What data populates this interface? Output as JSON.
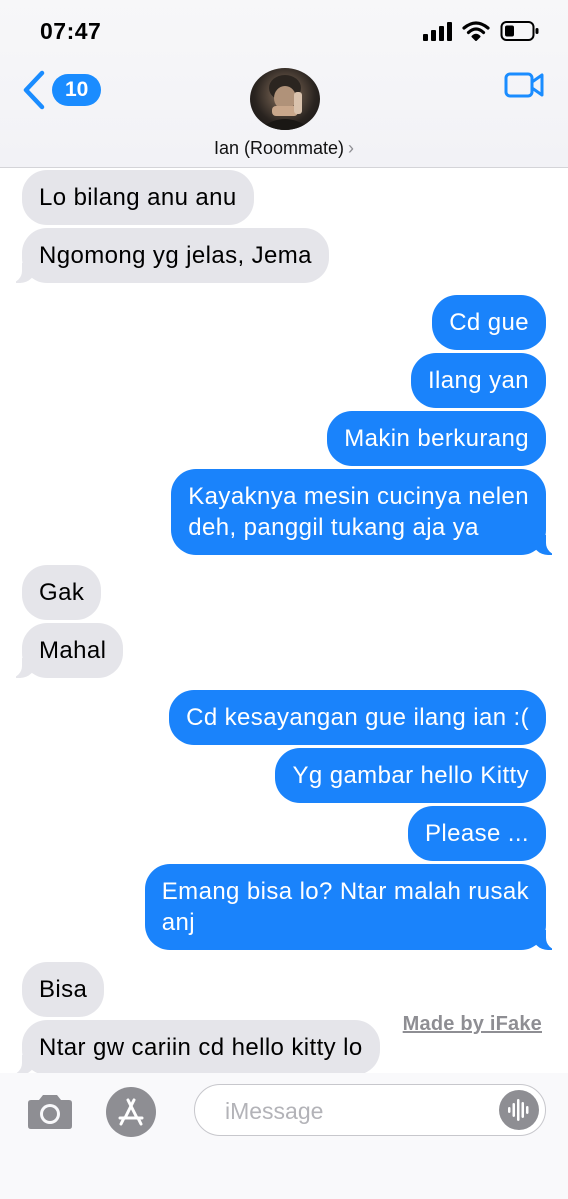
{
  "status_bar": {
    "time": "07:47"
  },
  "header": {
    "back_badge": "10",
    "contact_name": "Ian (Roommate)",
    "chevron": "›"
  },
  "messages": [
    {
      "from": "them",
      "text": "Lo bilang anu anu"
    },
    {
      "from": "them",
      "text": "Ngomong yg jelas, Jema"
    },
    {
      "from": "me",
      "text": "Cd gue"
    },
    {
      "from": "me",
      "text": "Ilang yan"
    },
    {
      "from": "me",
      "text": "Makin berkurang"
    },
    {
      "from": "me",
      "lines": [
        "Kayaknya mesin cucinya nelen",
        "deh, panggil tukang aja ya"
      ]
    },
    {
      "from": "them",
      "text": "Gak"
    },
    {
      "from": "them",
      "text": "Mahal"
    },
    {
      "from": "me",
      "text": "Cd kesayangan gue ilang ian :("
    },
    {
      "from": "me",
      "text": "Yg gambar hello Kitty"
    },
    {
      "from": "me",
      "text": "Please ..."
    },
    {
      "from": "me",
      "lines": [
        "Emang bisa lo? Ntar malah rusak",
        "anj"
      ]
    },
    {
      "from": "them",
      "text": "Bisa"
    },
    {
      "from": "them",
      "text": "Ntar gw cariin cd hello kitty lo"
    }
  ],
  "watermark": "Made by iFake",
  "input_bar": {
    "placeholder": "iMessage"
  },
  "icons": {
    "back": "chevron-left-icon",
    "video": "video-camera-icon",
    "camera": "camera-icon",
    "app_store": "app-store-icon",
    "audio": "audio-waveform-icon",
    "signal": "cellular-signal-icon",
    "wifi": "wifi-icon",
    "battery": "battery-icon"
  },
  "colors": {
    "accent": "#1a8cff",
    "outgoing_bubble": "#1a83fb",
    "incoming_bubble": "#e5e5ea",
    "icon_gray": "#8e8e93"
  }
}
